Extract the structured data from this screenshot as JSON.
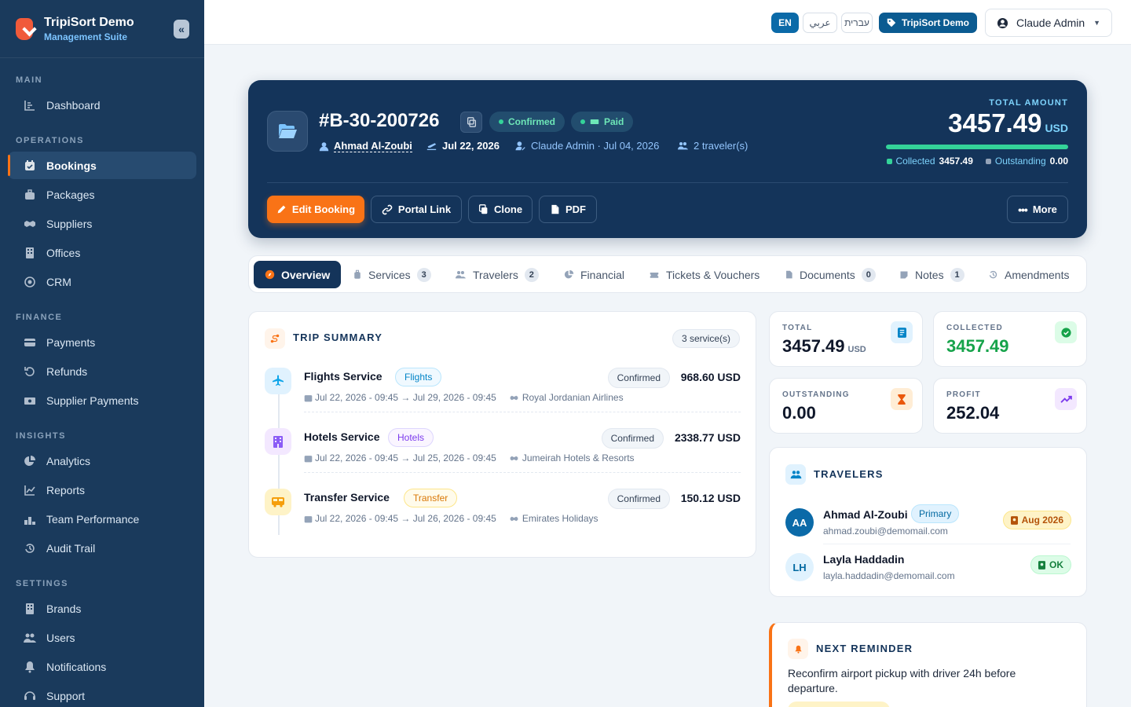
{
  "sidebar": {
    "brand_name": "TripiSort Demo",
    "brand_sub": "Management Suite",
    "sections": {
      "main": "MAIN",
      "operations": "OPERATIONS",
      "finance": "FINANCE",
      "insights": "INSIGHTS",
      "settings": "SETTINGS"
    },
    "items": {
      "dashboard": "Dashboard",
      "bookings": "Bookings",
      "packages": "Packages",
      "suppliers": "Suppliers",
      "offices": "Offices",
      "crm": "CRM",
      "payments": "Payments",
      "refunds": "Refunds",
      "supplier_payments": "Supplier Payments",
      "analytics": "Analytics",
      "reports": "Reports",
      "team_performance": "Team Performance",
      "audit_trail": "Audit Trail",
      "brands": "Brands",
      "users": "Users",
      "notifications": "Notifications",
      "support": "Support"
    },
    "active_item": "bookings"
  },
  "topbar": {
    "languages": [
      "EN",
      "عربي",
      "עברית"
    ],
    "active_language": "EN",
    "brand_chip": "TripiSort Demo",
    "user": "Claude Admin"
  },
  "booking": {
    "number": "#B-30-200726",
    "status": "Confirmed",
    "payment_status": "Paid",
    "customer": "Ahmad Al-Zoubi",
    "travel_date": "Jul 22, 2026",
    "created_by": "Claude Admin · Jul 04, 2026",
    "travelers": "2 traveler(s)",
    "total_label": "TOTAL AMOUNT",
    "total": "3457.49",
    "currency": "USD",
    "collected_fraction": 1.0,
    "collected_label": "Collected",
    "collected": "3457.49",
    "outstanding_label": "Outstanding",
    "outstanding": "0.00",
    "actions": {
      "edit": "Edit Booking",
      "portal": "Portal Link",
      "clone": "Clone",
      "pdf": "PDF",
      "more": "More"
    }
  },
  "tabs": [
    {
      "label": "Overview",
      "count": ""
    },
    {
      "label": "Services",
      "count": "3"
    },
    {
      "label": "Travelers",
      "count": "2"
    },
    {
      "label": "Financial",
      "count": ""
    },
    {
      "label": "Tickets & Vouchers",
      "count": ""
    },
    {
      "label": "Documents",
      "count": "0"
    },
    {
      "label": "Notes",
      "count": "1"
    },
    {
      "label": "Amendments",
      "count": ""
    }
  ],
  "trip_summary": {
    "title": "TRIP SUMMARY",
    "count": "3 service(s)",
    "services": [
      {
        "name": "Flights Service",
        "tag": "Flights",
        "status": "Confirmed",
        "price": "968.60 USD",
        "dates": "Jul 22, 2026 - 09:45 → Jul 29, 2026 - 09:45",
        "supplier": "Royal Jordanian Airlines"
      },
      {
        "name": "Hotels Service",
        "tag": "Hotels",
        "status": "Confirmed",
        "price": "2338.77 USD",
        "dates": "Jul 22, 2026 - 09:45 → Jul 25, 2026 - 09:45",
        "supplier": "Jumeirah Hotels & Resorts"
      },
      {
        "name": "Transfer Service",
        "tag": "Transfer",
        "status": "Confirmed",
        "price": "150.12 USD",
        "dates": "Jul 22, 2026 - 09:45 → Jul 26, 2026 - 09:45",
        "supplier": "Emirates Holidays"
      }
    ]
  },
  "stats": {
    "total": {
      "label": "TOTAL",
      "value": "3457.49",
      "unit": "USD"
    },
    "collected": {
      "label": "COLLECTED",
      "value": "3457.49"
    },
    "outstanding": {
      "label": "OUTSTANDING",
      "value": "0.00"
    },
    "profit": {
      "label": "PROFIT",
      "value": "252.04"
    }
  },
  "travelers": {
    "title": "TRAVELERS",
    "list": [
      {
        "initials": "AA",
        "name": "Ahmad Al-Zoubi",
        "badge": "Primary",
        "email": "ahmad.zoubi@demomail.com",
        "doc": "Aug 2026"
      },
      {
        "initials": "LH",
        "name": "Layla Haddadin",
        "badge": "",
        "email": "layla.haddadin@demomail.com",
        "doc": "OK"
      }
    ]
  },
  "reminder": {
    "title": "NEXT REMINDER",
    "text": "Reconfirm airport pickup with driver 24h before departure."
  }
}
